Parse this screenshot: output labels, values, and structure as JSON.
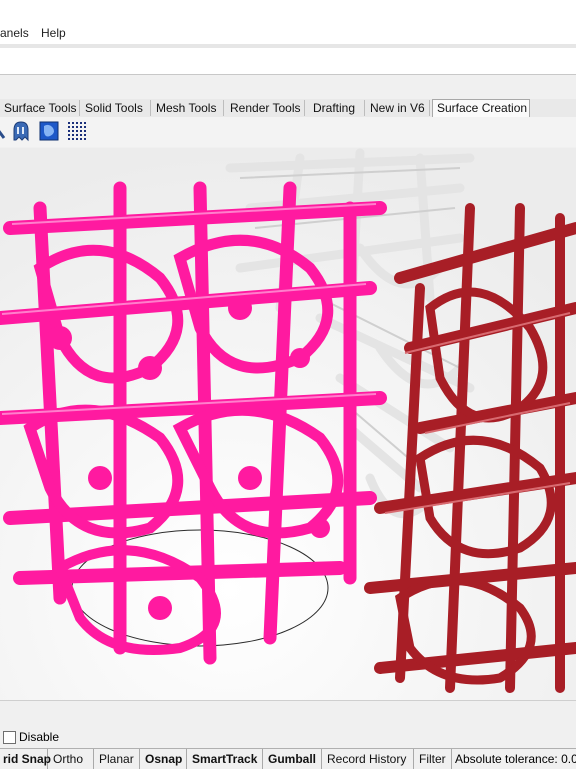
{
  "menu": {
    "items": [
      "anels",
      "Help"
    ]
  },
  "command": {
    "value": ""
  },
  "tabs": [
    "Surface Tools",
    "Solid Tools",
    "Mesh Tools",
    "Render Tools",
    "Drafting",
    "New in V6",
    "Surface Creation"
  ],
  "active_tab": "Surface Creation",
  "toolbar": {
    "icons": [
      "ghost-icon",
      "picture-surface-icon",
      "point-grid-icon"
    ]
  },
  "options": {
    "disable_label": "Disable",
    "disable_checked": false
  },
  "status": {
    "grid_snap": "rid Snap",
    "ortho": "Ortho",
    "planar": "Planar",
    "osnap": "Osnap",
    "smarttrack": "SmartTrack",
    "gumball": "Gumball",
    "record_history": "Record History",
    "filter": "Filter",
    "tolerance": "Absolute tolerance: 0.0"
  },
  "colors": {
    "magenta": "#ff1aa0",
    "red": "#a81e26",
    "white_object": "#e8e8e8"
  }
}
